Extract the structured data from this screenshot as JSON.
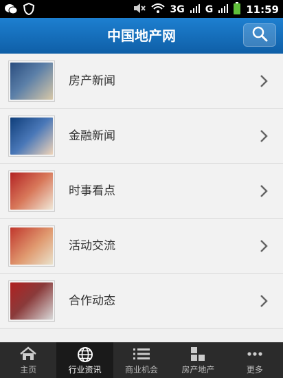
{
  "statusbar": {
    "network_1": "3G",
    "network_2": "G",
    "time": "11:59"
  },
  "header": {
    "title": "中国地产网"
  },
  "list": {
    "items": [
      {
        "label": "房产新闻",
        "thumb_colors": [
          "#2a4d7f",
          "#d8c8a8"
        ]
      },
      {
        "label": "金融新闻",
        "thumb_colors": [
          "#0f3e7a",
          "#f0d4b8"
        ]
      },
      {
        "label": "时事看点",
        "thumb_colors": [
          "#b32424",
          "#f0e8d8"
        ]
      },
      {
        "label": "活动交流",
        "thumb_colors": [
          "#c0362c",
          "#eae2cc"
        ]
      },
      {
        "label": "合作动态",
        "thumb_colors": [
          "#b02020",
          "#d9d9d9"
        ]
      }
    ]
  },
  "tabbar": {
    "tabs": [
      {
        "label": "主页"
      },
      {
        "label": "行业资讯"
      },
      {
        "label": "商业机会"
      },
      {
        "label": "房产地产"
      },
      {
        "label": "更多"
      }
    ]
  },
  "colors": {
    "header": "#1470c0",
    "tabbar": "#2b2b2b"
  }
}
